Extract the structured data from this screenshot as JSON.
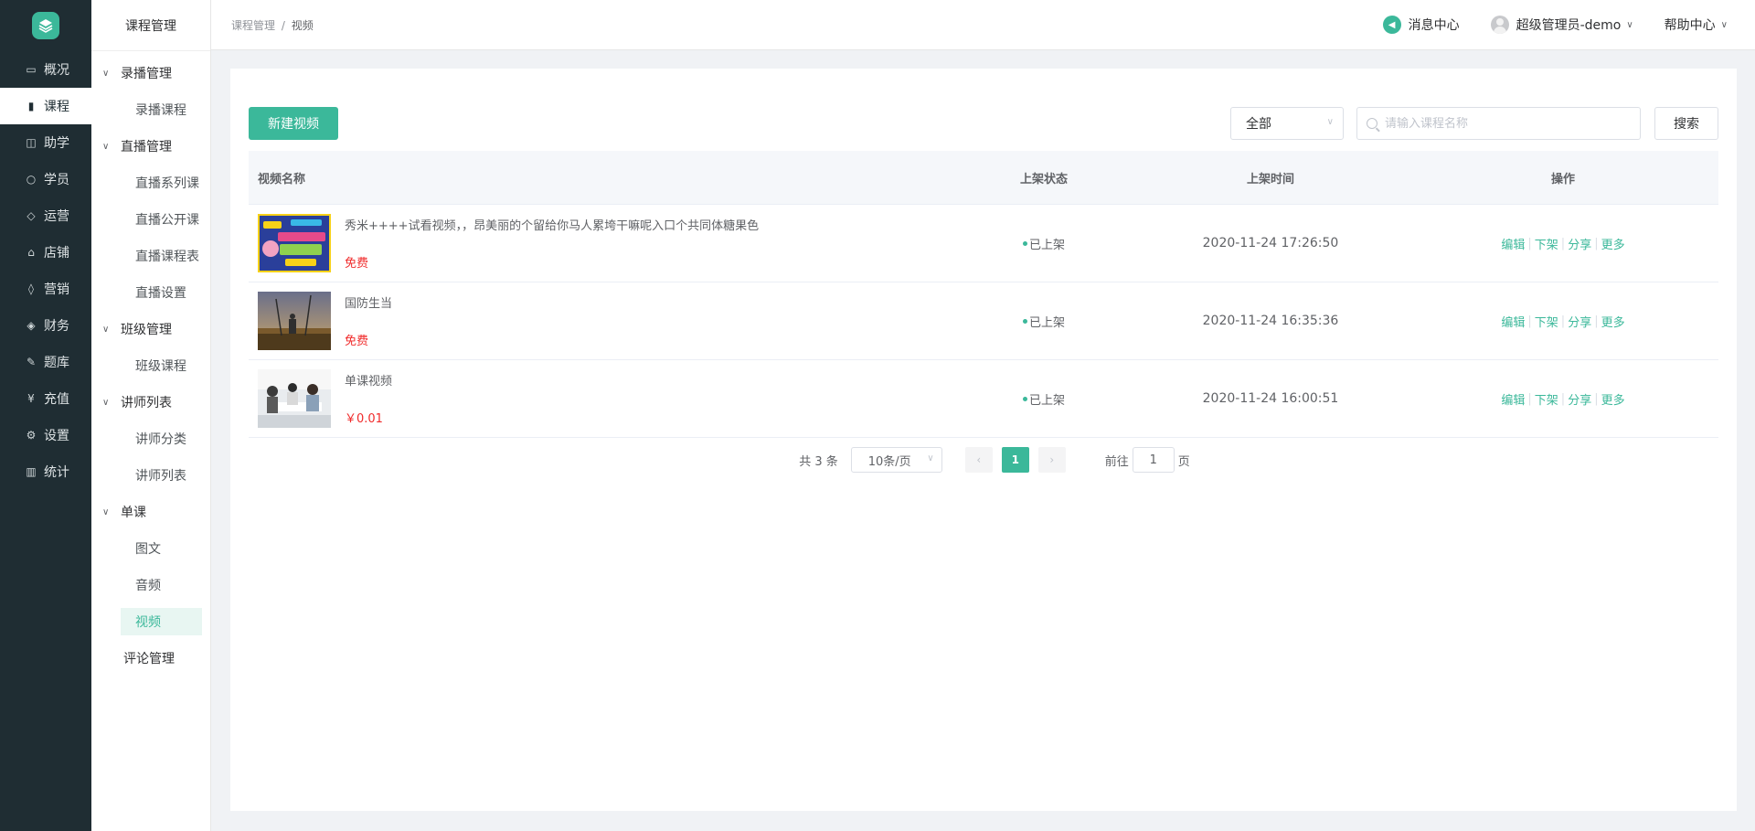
{
  "nav": {
    "items": [
      {
        "label": "概况",
        "icon": "monitor-icon"
      },
      {
        "label": "课程",
        "icon": "book-icon"
      },
      {
        "label": "助学",
        "icon": "box-icon"
      },
      {
        "label": "学员",
        "icon": "user-icon"
      },
      {
        "label": "运营",
        "icon": "cube-icon"
      },
      {
        "label": "店铺",
        "icon": "store-icon"
      },
      {
        "label": "营销",
        "icon": "tag-icon"
      },
      {
        "label": "财务",
        "icon": "wallet-icon"
      },
      {
        "label": "题库",
        "icon": "pen-icon"
      },
      {
        "label": "充值",
        "icon": "yen-icon"
      },
      {
        "label": "设置",
        "icon": "gear-icon"
      },
      {
        "label": "统计",
        "icon": "bar-chart-icon"
      }
    ],
    "active_index": 1
  },
  "submenu": {
    "title": "课程管理",
    "groups": {
      "g0": "录播管理",
      "g0i0": "录播课程",
      "g1": "直播管理",
      "g1i0": "直播系列课",
      "g1i1": "直播公开课",
      "g1i2": "直播课程表",
      "g1i3": "直播设置",
      "g2": "班级管理",
      "g2i0": "班级课程",
      "g3": "讲师列表",
      "g3i0": "讲师分类",
      "g3i1": "讲师列表",
      "g4": "单课",
      "g4i0": "图文",
      "g4i1": "音频",
      "g4i2": "视频",
      "plain": "评论管理"
    }
  },
  "header": {
    "breadcrumb_parent": "课程管理",
    "breadcrumb_sep": "/",
    "breadcrumb_current": "视频",
    "messages": "消息中心",
    "user": "超级管理员-demo",
    "help": "帮助中心"
  },
  "toolbar": {
    "new_button": "新建视频",
    "filter_value": "全部",
    "search_placeholder": "请输入课程名称",
    "search_button": "搜索"
  },
  "table": {
    "headers": {
      "name": "视频名称",
      "status": "上架状态",
      "time": "上架时间",
      "ops": "操作"
    },
    "rows": [
      {
        "title": "秀米++++试看视频，，昂美丽的个留给你马人累垮干嘛呢入口个共同体糖果色",
        "price": "免费",
        "status": "已上架",
        "time": "2020-11-24 17:26:50"
      },
      {
        "title": "国防生当",
        "price": "免费",
        "status": "已上架",
        "time": "2020-11-24 16:35:36"
      },
      {
        "title": "单课视频",
        "price": "￥0.01",
        "status": "已上架",
        "time": "2020-11-24 16:00:51"
      }
    ],
    "ops": {
      "edit": "编辑",
      "offshelf": "下架",
      "share": "分享",
      "more": "更多"
    }
  },
  "pagination": {
    "total": "共 3 条",
    "page_size": "10条/页",
    "current_page": "1",
    "goto_prefix": "前往",
    "goto_value": "1",
    "goto_suffix": "页"
  },
  "colors": {
    "accent": "#3bb89a",
    "nav_bg": "#1f2d33",
    "price": "#f02b2b"
  }
}
